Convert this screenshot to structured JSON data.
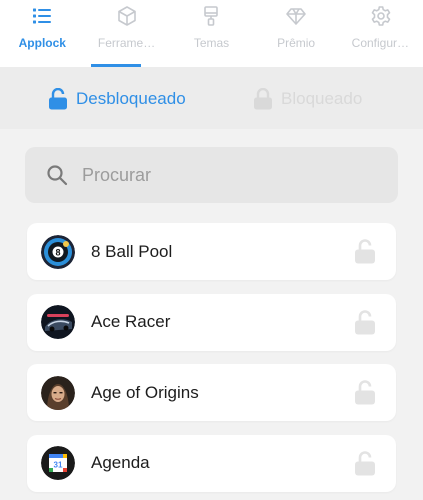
{
  "nav": {
    "items": [
      {
        "label": "Applock",
        "icon": "list-icon"
      },
      {
        "label": "Ferramentas",
        "icon": "cube-icon"
      },
      {
        "label": "Temas",
        "icon": "paint-brush-icon"
      },
      {
        "label": "Prêmio",
        "icon": "diamond-icon"
      },
      {
        "label": "Configurações",
        "icon": "gear-icon"
      }
    ],
    "active_index": 0
  },
  "lock_tabs": {
    "unlocked_label": "Desbloqueado",
    "locked_label": "Bloqueado",
    "active": "unlocked"
  },
  "search": {
    "placeholder": "Procurar"
  },
  "apps": [
    {
      "name": "8 Ball Pool",
      "icon": "8-ball-pool-icon",
      "locked": false
    },
    {
      "name": "Ace Racer",
      "icon": "ace-racer-icon",
      "locked": false
    },
    {
      "name": "Age of Origins",
      "icon": "age-of-origins-icon",
      "locked": false
    },
    {
      "name": "Agenda",
      "icon": "agenda-icon",
      "locked": false
    }
  ],
  "colors": {
    "accent": "#2f8fe6",
    "inactive": "#c6c9ce",
    "background": "#f2f2f2"
  }
}
